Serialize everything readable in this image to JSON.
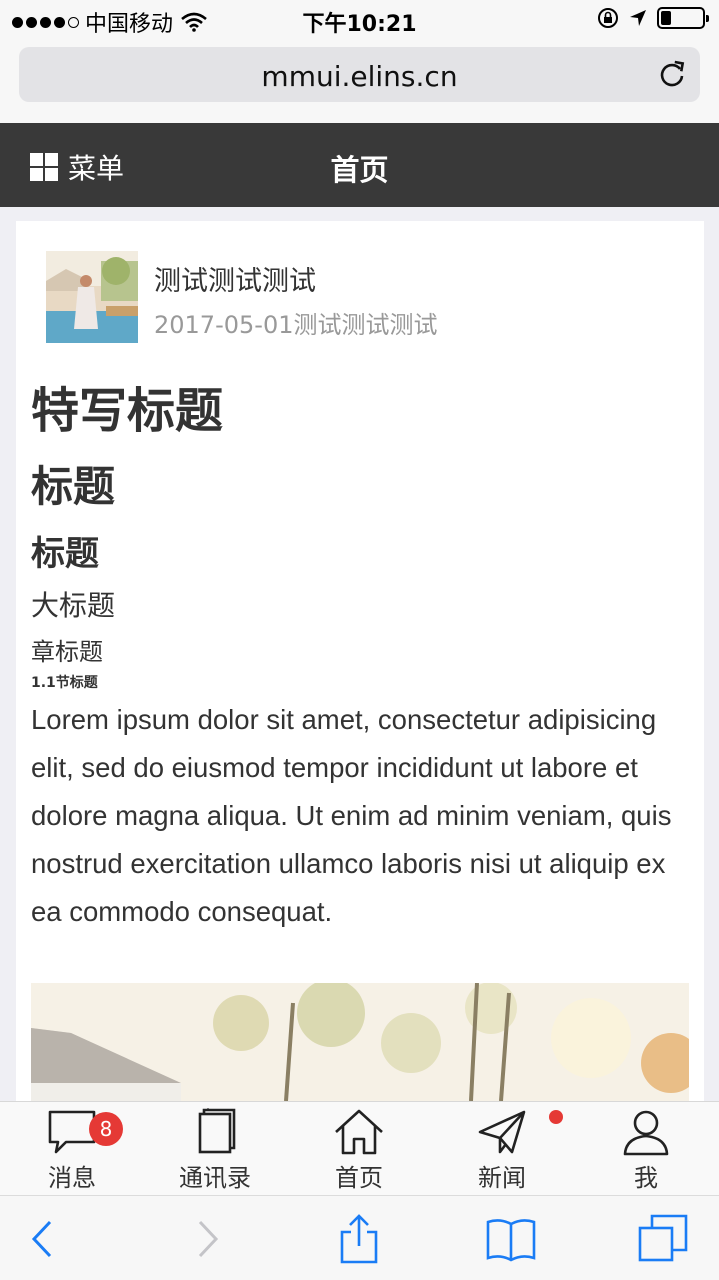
{
  "status_bar": {
    "carrier": "中国移动",
    "time": "下午10:21"
  },
  "browser": {
    "url": "mmui.elins.cn"
  },
  "header": {
    "menu_label": "菜单",
    "title": "首页"
  },
  "article": {
    "author_name": "测试测试测试",
    "author_meta": "2017-05-01测试测试测试",
    "headings": {
      "feature": "特写标题",
      "h1": "标题",
      "h2": "标题",
      "h3": "大标题",
      "h4": "章标题",
      "h5": "1.1节标题"
    },
    "body": "Lorem ipsum dolor sit amet, consectetur adipisicing elit, sed do eiusmod tempor incididunt ut labore et dolore magna aliqua. Ut enim ad minim veniam, quis nostrud exercitation ullamco laboris nisi ut aliquip ex ea commodo consequat."
  },
  "tabbar": {
    "items": [
      {
        "label": "消息",
        "icon": "message-icon",
        "badge": "8"
      },
      {
        "label": "通讯录",
        "icon": "contacts-icon"
      },
      {
        "label": "首页",
        "icon": "home-icon"
      },
      {
        "label": "新闻",
        "icon": "news-icon",
        "dot": true
      },
      {
        "label": "我",
        "icon": "user-icon"
      }
    ]
  },
  "colors": {
    "header_bg": "#393939",
    "badge": "#e53935",
    "safari_blue": "#1a7cf5"
  }
}
